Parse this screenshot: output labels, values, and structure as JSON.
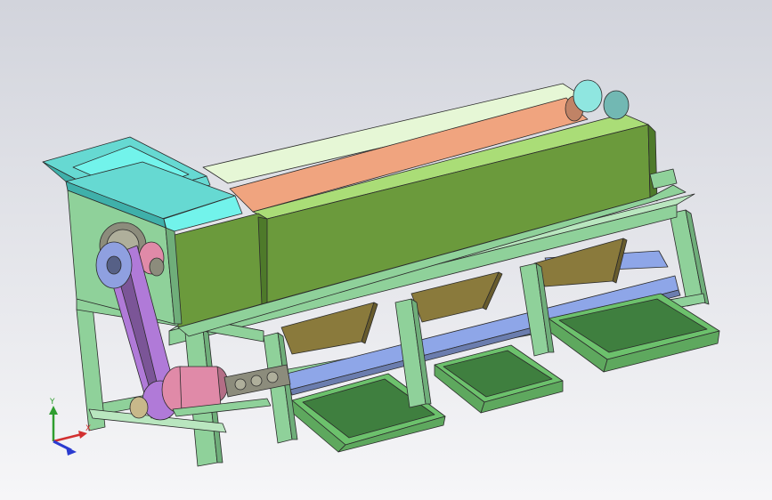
{
  "viewport": {
    "background_top": "#d2d4dc",
    "background_bottom": "#f6f6f8"
  },
  "triad": {
    "y_label": "Y",
    "x_label": "X",
    "y_color": "#2f9e2f",
    "x_color": "#d23030",
    "z_color": "#2a3bd0"
  },
  "colors": {
    "frame": "#8fd19a",
    "frame_dark": "#6fae7a",
    "frame_top": "#b9e6bf",
    "drum_cover": "#6b9a3c",
    "drum_cover_top": "#aadd77",
    "drum_cover_dark": "#4e7a2a",
    "drum_open_light": "#e6f7d6",
    "roller_salmon": "#f0a47f",
    "hopper_cyan": "#66d9d2",
    "hopper_dark": "#3fb0aa",
    "funnel_brown": "#8a7a3c",
    "conveyor_blue": "#8ea6e8",
    "tray_green": "#5ea85e",
    "tray_inner": "#3f7f3f",
    "belt_purple": "#b07ad8",
    "pulley_blue": "#8fa0e0",
    "motor_pink": "#e08aa8",
    "gear_gray": "#8c8c7c",
    "bearing_cyan": "#8fe6e0"
  }
}
